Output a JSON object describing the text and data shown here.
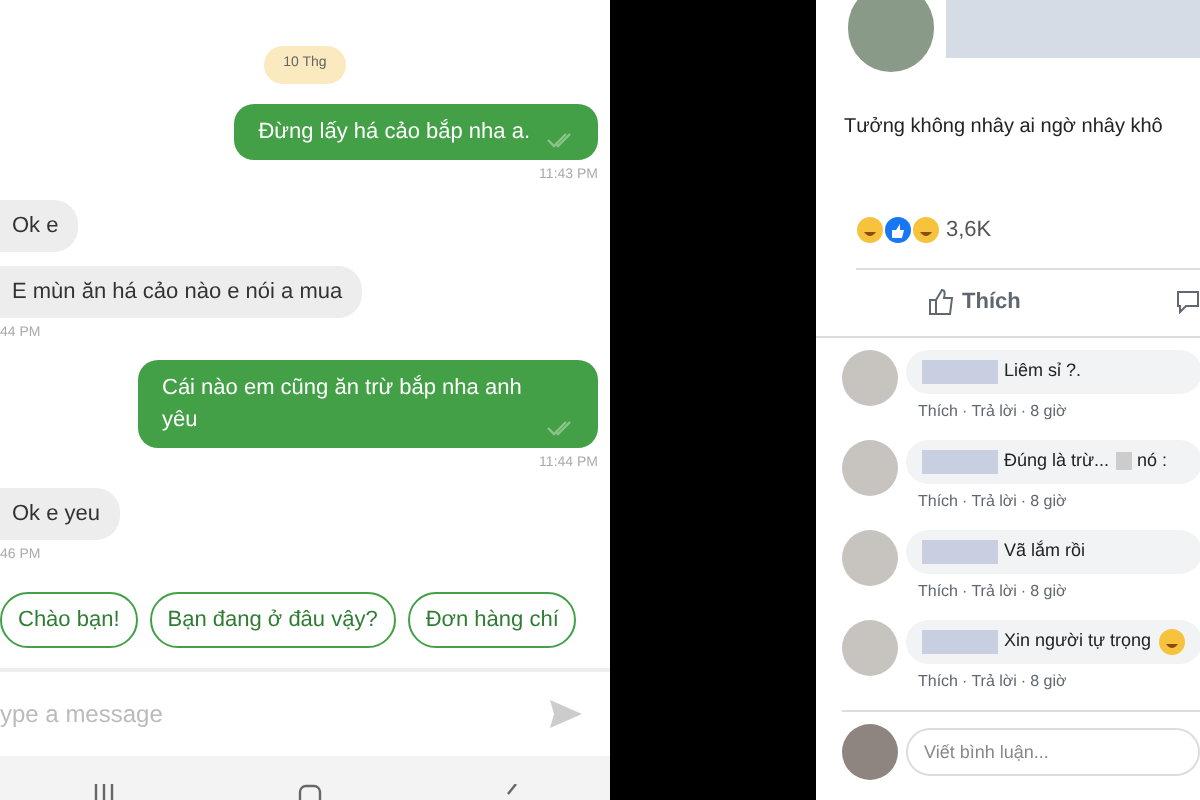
{
  "chat": {
    "date_chip": "10 Thg",
    "messages": [
      {
        "kind": "out",
        "text": "Đừng lấy há cảo bắp nha a.",
        "time": "11:43 PM",
        "read": true
      },
      {
        "kind": "in",
        "text": "Ok e"
      },
      {
        "kind": "in",
        "text": "E mùn ăn há cảo nào e nói a mua",
        "time": "44 PM"
      },
      {
        "kind": "out",
        "text": "Cái nào em cũng ăn trừ bắp nha anh yêu",
        "time": "11:44 PM",
        "read": true
      },
      {
        "kind": "in",
        "text": "Ok e yeu",
        "time": "46 PM"
      }
    ],
    "suggestions": [
      "Chào bạn!",
      "Bạn đang ở đâu vậy?",
      "Đơn hàng chí"
    ],
    "input": {
      "placeholder": "ype a message"
    }
  },
  "post": {
    "text": "Tưởng không nhây ai ngờ nhây khô",
    "reaction_count": "3,6K",
    "like_button": "Thích",
    "comments": [
      {
        "text": "Liêm sỉ ?.",
        "actions": [
          "Thích",
          "Trả lời",
          "8 giờ"
        ],
        "separator": "·"
      },
      {
        "text": "Đúng là trừ...",
        "tail": "nó :",
        "actions": [
          "Thích",
          "Trả lời",
          "8 giờ"
        ],
        "separator": "·"
      },
      {
        "text": "Vã lắm rồi",
        "actions": [
          "Thích",
          "Trả lời",
          "8 giờ"
        ],
        "separator": "·"
      },
      {
        "text": "Xin người tự trọng",
        "emoji": true,
        "actions": [
          "Thích",
          "Trả lời",
          "8 giờ"
        ],
        "separator": "·"
      }
    ],
    "comment_input": {
      "placeholder": "Viết bình luận..."
    }
  }
}
